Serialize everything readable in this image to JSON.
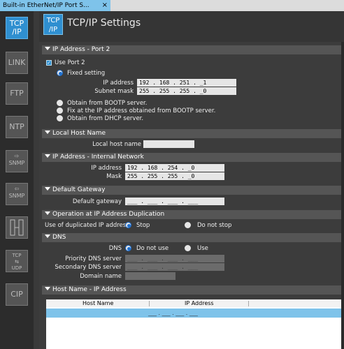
{
  "tab": {
    "title": "Built-in EtherNet/IP Port S...",
    "close": "×"
  },
  "sidebar": {
    "items": [
      {
        "label": "TCP/IP",
        "active": true
      },
      {
        "label": "LINK"
      },
      {
        "label": "FTP"
      },
      {
        "label": "NTP"
      },
      {
        "label": "SNMP",
        "sub": "send"
      },
      {
        "label": "SNMP",
        "sub": "receive"
      },
      {
        "label": "FINS"
      },
      {
        "label": "TCP UDP"
      },
      {
        "label": "CIP"
      }
    ]
  },
  "header": {
    "logo": "TCP/IP",
    "title": "TCP/IP Settings"
  },
  "port2": {
    "section": "IP Address - Port 2",
    "use_port": "Use Port 2",
    "fixed": "Fixed setting",
    "ip_label": "IP address",
    "ip_value": "192 . 168 . 251 . _1",
    "mask_label": "Subnet mask",
    "mask_value": "255 . 255 . 255 . _0",
    "bootp": "Obtain from BOOTP server.",
    "bootp_fix": "Fix at the IP address obtained from BOOTP server.",
    "dhcp": "Obtain from DHCP server."
  },
  "local_host": {
    "section": "Local Host Name",
    "label": "Local host name",
    "value": ""
  },
  "internal": {
    "section": "IP Address - Internal Network",
    "ip_label": "IP address",
    "ip_value": "192 . 168 . 254 . _0",
    "mask_label": "Mask",
    "mask_value": "255 . 255 . 255 . _0"
  },
  "gateway": {
    "section": "Default Gateway",
    "label": "Default gateway",
    "value": "___ . ___ . ___ . ___"
  },
  "duplication": {
    "section": "Operation at IP Address Duplication",
    "label": "Use of duplicated IP address",
    "stop": "Stop",
    "not_stop": "Do not stop"
  },
  "dns": {
    "section": "DNS",
    "label": "DNS",
    "not_use": "Do not use",
    "use": "Use",
    "priority_label": "Priority DNS server",
    "priority_value": "___ . ___ . ___ . ___",
    "secondary_label": "Secondary DNS server",
    "secondary_value": "___ . ___ . ___ . ___",
    "domain_label": "Domain name",
    "domain_value": ""
  },
  "hosts": {
    "section": "Host Name - IP Address",
    "col_host": "Host Name",
    "col_ip": "IP Address",
    "row_ip": "___ . ___ . ___ . ___"
  }
}
